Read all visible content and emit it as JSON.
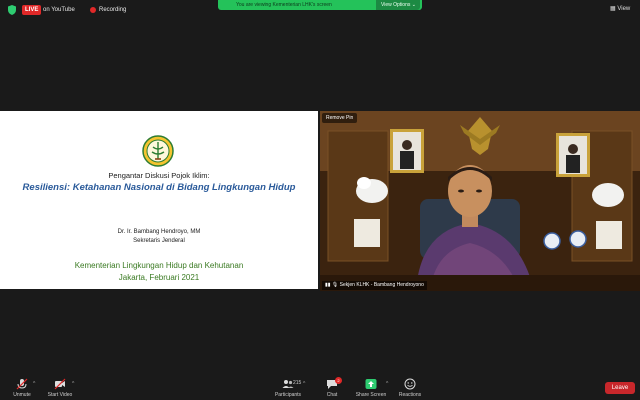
{
  "topbar": {
    "live_label": "LIVE",
    "live_text": "on YouTube",
    "recording_text": "Recording",
    "viewing_text": "You are viewing Kementerian LHK's screen",
    "view_options_label": "View Options",
    "view_button_label": "View"
  },
  "slide": {
    "subtitle": "Pengantar Diskusi Pojok Iklim:",
    "title": "Resiliensi: Ketahanan Nasional di Bidang Lingkungan Hidup",
    "presenter": "Dr. Ir. Bambang Hendroyo, MM",
    "role": "Sekretaris Jenderal",
    "ministry": "Kementerian Lingkungan Hidup dan Kehutanan",
    "place_date": "Jakarta, Februari 2021"
  },
  "video": {
    "remove_pin_label": "Remove Pin",
    "participant_name": "Sekjen KLHK - Bambang Hendroyono"
  },
  "toolbar": {
    "unmute_label": "Unmute",
    "start_video_label": "Start Video",
    "participants_label": "Participants",
    "participants_count": "215",
    "chat_label": "Chat",
    "chat_badge": "2",
    "share_screen_label": "Share Screen",
    "reactions_label": "Reactions",
    "leave_label": "Leave"
  },
  "colors": {
    "live_red": "#e02828",
    "viewing_green": "#24c25a",
    "share_green": "#2ecc71",
    "leave_red": "#c8272b",
    "slide_title_blue": "#2a5a9a",
    "slide_ministry_green": "#3a7a22"
  },
  "icons": [
    "shield-icon",
    "recording-dot-icon",
    "microphone-muted-icon",
    "camera-off-icon",
    "participants-icon",
    "chat-icon",
    "share-screen-icon",
    "reactions-icon",
    "ministry-logo"
  ]
}
